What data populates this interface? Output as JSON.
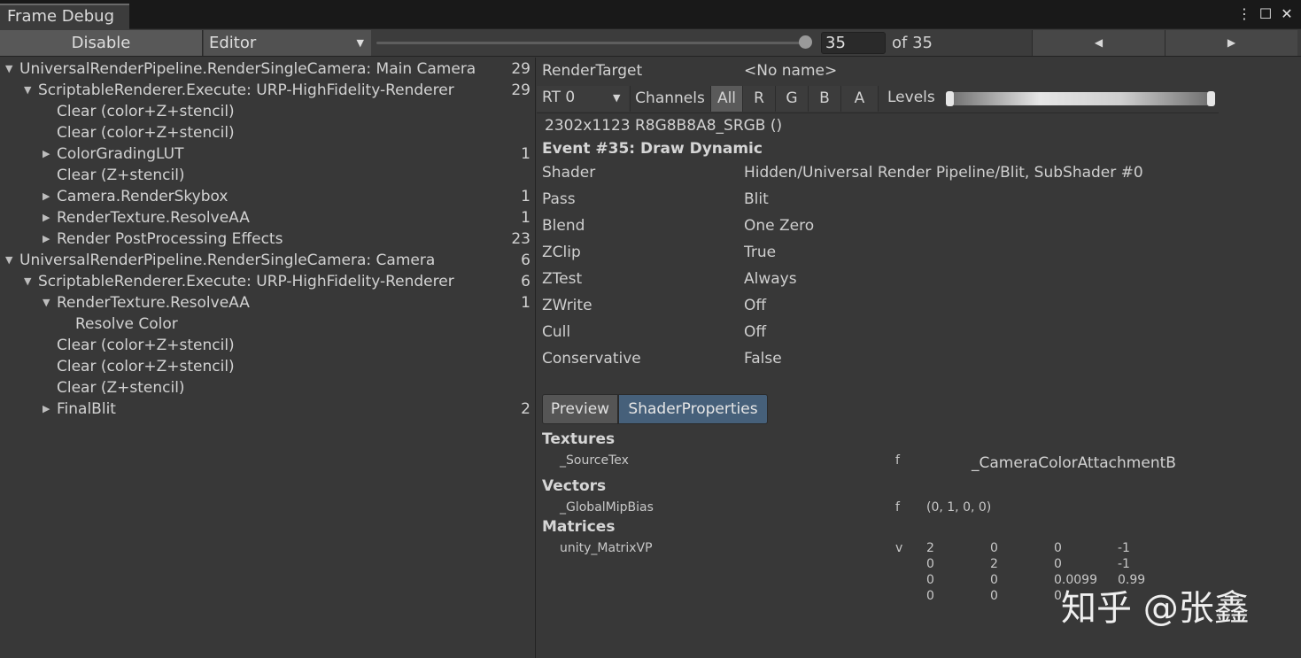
{
  "window": {
    "tab_title": "Frame Debug",
    "buttons": [
      "⋮",
      "☐",
      "✕"
    ]
  },
  "toolbar": {
    "disable_label": "Disable",
    "target_dropdown": "Editor",
    "frame_value": "35",
    "frame_total_label": "of 35",
    "slider_position": 1.0,
    "prev_icon": "◀",
    "next_icon": "▶"
  },
  "tree": [
    {
      "depth": 0,
      "expand": "open",
      "label": "UniversalRenderPipeline.RenderSingleCamera: Main Camera",
      "count": "29"
    },
    {
      "depth": 1,
      "expand": "open",
      "label": "ScriptableRenderer.Execute: URP-HighFidelity-Renderer",
      "count": "29"
    },
    {
      "depth": 2,
      "expand": "none",
      "label": "Clear (color+Z+stencil)",
      "count": ""
    },
    {
      "depth": 2,
      "expand": "none",
      "label": "Clear (color+Z+stencil)",
      "count": ""
    },
    {
      "depth": 2,
      "expand": "closed",
      "label": "ColorGradingLUT",
      "count": "1"
    },
    {
      "depth": 2,
      "expand": "none",
      "label": "Clear (Z+stencil)",
      "count": ""
    },
    {
      "depth": 2,
      "expand": "closed",
      "label": "Camera.RenderSkybox",
      "count": "1"
    },
    {
      "depth": 2,
      "expand": "closed",
      "label": "RenderTexture.ResolveAA",
      "count": "1"
    },
    {
      "depth": 2,
      "expand": "closed",
      "label": "Render PostProcessing Effects",
      "count": "23"
    },
    {
      "depth": 0,
      "expand": "open",
      "label": "UniversalRenderPipeline.RenderSingleCamera: Camera",
      "count": "6"
    },
    {
      "depth": 1,
      "expand": "open",
      "label": "ScriptableRenderer.Execute: URP-HighFidelity-Renderer",
      "count": "6"
    },
    {
      "depth": 2,
      "expand": "open",
      "label": "RenderTexture.ResolveAA",
      "count": "1"
    },
    {
      "depth": 3,
      "expand": "none",
      "label": "Resolve Color",
      "count": ""
    },
    {
      "depth": 2,
      "expand": "none",
      "label": "Clear (color+Z+stencil)",
      "count": ""
    },
    {
      "depth": 2,
      "expand": "none",
      "label": "Clear (color+Z+stencil)",
      "count": ""
    },
    {
      "depth": 2,
      "expand": "none",
      "label": "Clear (Z+stencil)",
      "count": ""
    },
    {
      "depth": 2,
      "expand": "closed",
      "label": "FinalBlit",
      "count": "2"
    }
  ],
  "render_target": {
    "label": "RenderTarget",
    "value": "<No name>",
    "rt_dropdown": "RT 0",
    "channels_label": "Channels",
    "channels": [
      "All",
      "R",
      "G",
      "B",
      "A"
    ],
    "active_channel": "All",
    "levels_label": "Levels",
    "format": "2302x1123 R8G8B8A8_SRGB ()"
  },
  "event": {
    "title": "Event #35: Draw Dynamic",
    "props": [
      {
        "key": "Shader",
        "value": "Hidden/Universal Render Pipeline/Blit, SubShader #0"
      },
      {
        "key": "Pass",
        "value": "Blit"
      },
      {
        "key": "Blend",
        "value": "One Zero"
      },
      {
        "key": "ZClip",
        "value": "True"
      },
      {
        "key": "ZTest",
        "value": "Always"
      },
      {
        "key": "ZWrite",
        "value": "Off"
      },
      {
        "key": "Cull",
        "value": "Off"
      },
      {
        "key": "Conservative",
        "value": "False"
      }
    ]
  },
  "detail_tabs": {
    "preview": "Preview",
    "shader_properties": "ShaderProperties",
    "active": "ShaderProperties"
  },
  "shader_props": {
    "textures_header": "Textures",
    "textures": [
      {
        "name": "_SourceTex",
        "stage": "f",
        "value": "_CameraColorAttachmentB"
      }
    ],
    "vectors_header": "Vectors",
    "vectors": [
      {
        "name": "_GlobalMipBias",
        "stage": "f",
        "value": "(0, 1, 0, 0)"
      }
    ],
    "matrices_header": "Matrices",
    "matrices": [
      {
        "name": "unity_MatrixVP",
        "stage": "v",
        "rows": [
          [
            "2",
            "0",
            "0",
            "-1"
          ],
          [
            "0",
            "2",
            "0",
            "-1"
          ],
          [
            "0",
            "0",
            "0.0099",
            "0.99"
          ],
          [
            "0",
            "0",
            "0",
            ""
          ]
        ]
      }
    ]
  },
  "watermark": "知乎 @张鑫"
}
